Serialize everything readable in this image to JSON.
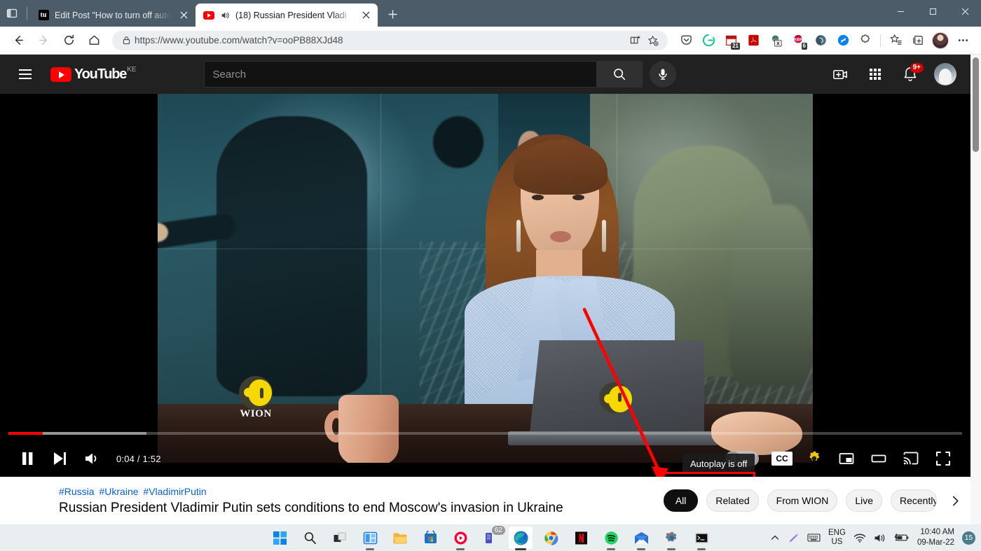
{
  "browser": {
    "tab_search_icon": "tab-search-icon",
    "tabs": [
      {
        "title": "Edit Post \"How to turn off autopl",
        "favicon": "tumblr-icon",
        "active": false,
        "audio": false
      },
      {
        "title": "(18) Russian President Vladi",
        "favicon": "youtube-icon",
        "active": true,
        "audio": true
      }
    ],
    "new_tab_label": "+",
    "window_controls": {
      "minimize": "–",
      "maximize": "□",
      "close": "✕"
    },
    "nav": {
      "back": "back-icon",
      "forward": "forward-icon",
      "reload": "reload-icon",
      "home": "home-icon"
    },
    "address": {
      "lock_icon": "lock-icon",
      "url": "https://www.youtube.com/watch?v=ooPB88XJd48",
      "split_screen_icon": "split-screen-icon",
      "favorite_icon": "add-favorite-icon"
    },
    "extensions": [
      {
        "name": "pocket-extension",
        "glyph": "▽"
      },
      {
        "name": "grammarly-extension",
        "glyph": "G"
      },
      {
        "name": "calendar-extension",
        "badge": "21"
      },
      {
        "name": "adobe-acrobat-extension",
        "glyph": "A"
      },
      {
        "name": "excel-converter-extension",
        "glyph": "X"
      },
      {
        "name": "abbyy-extension",
        "badge": "6"
      },
      {
        "name": "dark-reader-extension",
        "glyph": ""
      },
      {
        "name": "shazam-extension",
        "glyph": "S"
      },
      {
        "name": "extensions-puzzle-icon",
        "glyph": ""
      }
    ],
    "toolbar_right": {
      "favorites_icon": "favorites-icon",
      "collections_icon": "collections-icon",
      "profile_icon": "profile-avatar",
      "settings_more_icon": "more-options-icon"
    }
  },
  "youtube": {
    "header": {
      "menu_icon": "hamburger-menu-icon",
      "logo_text": "YouTube",
      "logo_country": "KE",
      "search_placeholder": "Search",
      "search_value": "",
      "search_icon": "search-icon",
      "mic_icon": "microphone-icon",
      "create_icon": "create-video-icon",
      "apps_icon": "youtube-apps-icon",
      "notifications_icon": "notifications-bell-icon",
      "notifications_count": "9+",
      "avatar": "account-avatar"
    },
    "player": {
      "state": "playing",
      "pause_icon": "pause-icon",
      "next_icon": "next-video-icon",
      "volume_icon": "volume-icon",
      "current_time": "0:04",
      "duration": "1:52",
      "time_display": "0:04 / 1:52",
      "progress_percent": 3.6,
      "buffered_percent": 14.5,
      "autoplay_toggle": {
        "name": "autoplay-toggle",
        "state": "off"
      },
      "tooltip": "Autoplay is off",
      "captions_label": "CC",
      "settings_icon": "settings-gear-icon",
      "miniplayer_icon": "miniplayer-icon",
      "theater_icon": "theater-mode-icon",
      "cast_icon": "cast-icon",
      "fullscreen_icon": "fullscreen-icon",
      "watermark": "WION"
    },
    "video_info": {
      "hashtags": [
        "#Russia",
        "#Ukraine",
        "#VladimirPutin"
      ],
      "title": "Russian President Vladimir Putin sets conditions to end Moscow's invasion in Ukraine"
    },
    "chips": [
      {
        "label": "All",
        "active": true
      },
      {
        "label": "Related",
        "active": false
      },
      {
        "label": "From WION",
        "active": false
      },
      {
        "label": "Live",
        "active": false
      },
      {
        "label": "Recently uploaded",
        "active": false,
        "clipped": true
      }
    ],
    "chips_next_icon": "chevron-right-icon"
  },
  "annotation": {
    "highlight_color": "#ff0000",
    "arrow_name": "red-annotation-arrow",
    "rect_name": "red-highlight-rectangle"
  },
  "taskbar": {
    "items": [
      {
        "name": "start-button",
        "label": "Start"
      },
      {
        "name": "taskbar-search",
        "label": "Search"
      },
      {
        "name": "taskbar-task-view",
        "label": "Task View"
      },
      {
        "name": "taskbar-widgets",
        "label": "Widgets"
      },
      {
        "name": "taskbar-file-explorer",
        "label": "File Explorer"
      },
      {
        "name": "taskbar-microsoft-store",
        "label": "Microsoft Store"
      },
      {
        "name": "taskbar-youtube-music",
        "label": "YouTube Music"
      },
      {
        "name": "taskbar-teams",
        "label": "Microsoft Teams",
        "badge": "62"
      },
      {
        "name": "taskbar-microsoft-edge",
        "label": "Microsoft Edge",
        "active": true
      },
      {
        "name": "taskbar-google-chrome",
        "label": "Google Chrome"
      },
      {
        "name": "taskbar-netflix",
        "label": "Netflix"
      },
      {
        "name": "taskbar-spotify",
        "label": "Spotify"
      },
      {
        "name": "taskbar-mail",
        "label": "Mail"
      },
      {
        "name": "taskbar-settings",
        "label": "Settings"
      },
      {
        "name": "taskbar-terminal",
        "label": "Terminal"
      }
    ],
    "tray": {
      "show_hidden_icon": "chevron-up-icon",
      "pen_icon": "pen-icon",
      "keyboard_icon": "touch-keyboard-icon",
      "language_line1": "ENG",
      "language_line2": "US",
      "wifi_icon": "wifi-icon",
      "volume_icon": "speaker-icon",
      "battery_icon": "battery-charging-icon",
      "time": "10:40 AM",
      "date": "09-Mar-22",
      "notification_count": "15"
    }
  }
}
